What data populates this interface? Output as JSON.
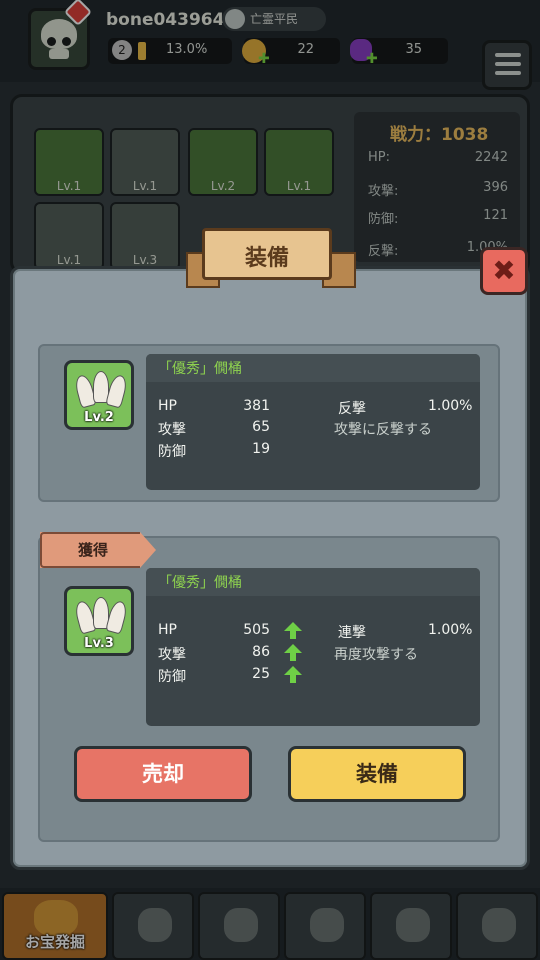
{
  "header": {
    "username": "bone043964",
    "rank": "亡霊平民",
    "level": "2",
    "exp_percent": "13.0%",
    "coins": "22",
    "gems": "35"
  },
  "equipment_slots": [
    {
      "level": "Lv.1"
    },
    {
      "level": "Lv.1"
    },
    {
      "level": "Lv.2"
    },
    {
      "level": "Lv.1"
    },
    {
      "level": "Lv.1"
    },
    {
      "level": "Lv.3"
    }
  ],
  "player_stats": {
    "power_label": "戦力：1038",
    "rows": [
      {
        "label": "HP:",
        "value": "2242"
      },
      {
        "label": "攻撃:",
        "value": "396"
      },
      {
        "label": "防御:",
        "value": "121"
      },
      {
        "label": "反撃:",
        "value": "1.00%"
      }
    ]
  },
  "modal": {
    "title": "装備",
    "close_icon": "✖",
    "current": {
      "level": "Lv.2",
      "name": "「優秀」僩桶",
      "stats": [
        {
          "label": "HP",
          "value": "381"
        },
        {
          "label": "攻撃",
          "value": "65"
        },
        {
          "label": "防御",
          "value": "19"
        }
      ],
      "special_label": "反撃",
      "special_value": "1.00%",
      "special_desc": "攻撃に反撃する"
    },
    "obtained_label": "獲得",
    "new_item": {
      "level": "Lv.3",
      "name": "「優秀」僩桶",
      "stats": [
        {
          "label": "HP",
          "value": "505"
        },
        {
          "label": "攻撃",
          "value": "86"
        },
        {
          "label": "防御",
          "value": "25"
        }
      ],
      "special_label": "連撃",
      "special_value": "1.00%",
      "special_desc": "再度攻撃する"
    },
    "sell_label": "売却",
    "equip_label": "装備"
  },
  "bottom_nav": {
    "treasure_label": "お宝発掘"
  },
  "colors": {
    "modal_bg": "#8e9aa1",
    "item_name": "#8ed34f",
    "up_arrow": "#6fd046",
    "sell": "#e77466",
    "equip": "#f6cf5a"
  }
}
